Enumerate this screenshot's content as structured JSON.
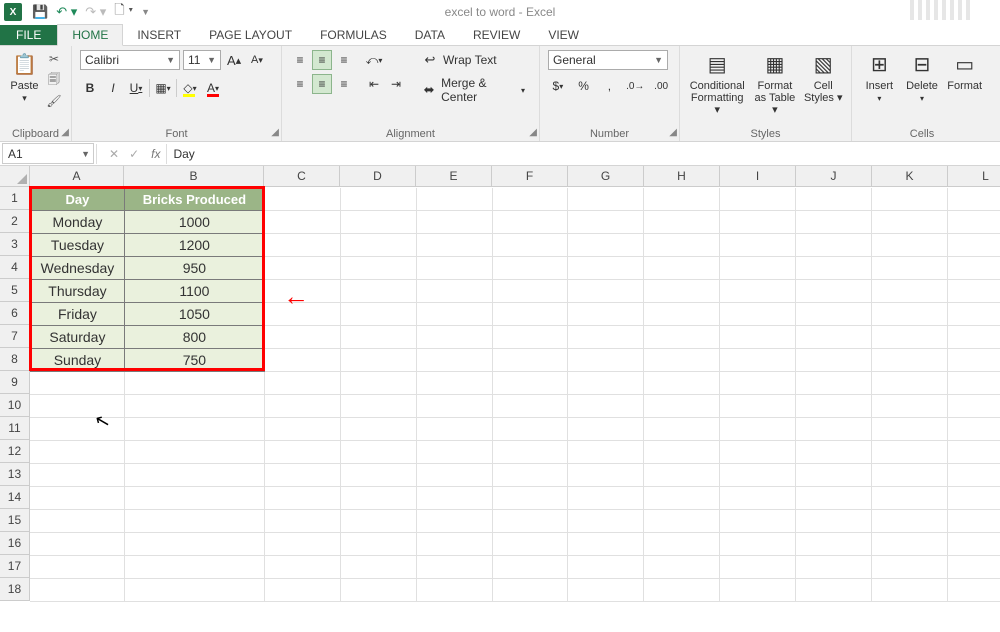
{
  "app": {
    "title": "excel to word - Excel",
    "icon_letter": "X"
  },
  "qat": {
    "save": "💾",
    "undo": "↶",
    "redo": "↷",
    "new": "🗋"
  },
  "tabs": [
    "FILE",
    "HOME",
    "INSERT",
    "PAGE LAYOUT",
    "FORMULAS",
    "DATA",
    "REVIEW",
    "VIEW"
  ],
  "active_tab": "HOME",
  "ribbon": {
    "clipboard": {
      "paste": "Paste",
      "label": "Clipboard"
    },
    "font": {
      "name": "Calibri",
      "size": "11",
      "bold": "B",
      "italic": "I",
      "underline": "U",
      "grow": "A",
      "shrink": "A",
      "label": "Font"
    },
    "alignment": {
      "wrap": "Wrap Text",
      "merge": "Merge & Center",
      "label": "Alignment"
    },
    "number": {
      "format": "General",
      "label": "Number"
    },
    "styles": {
      "cf": "Conditional Formatting",
      "ft": "Format as Table",
      "cs": "Cell Styles",
      "label": "Styles"
    },
    "cells": {
      "ins": "Insert",
      "del": "Delete",
      "fmt": "Format",
      "label": "Cells"
    }
  },
  "fbar": {
    "ref": "A1",
    "content": "Day"
  },
  "columns": [
    "A",
    "B",
    "C",
    "D",
    "E",
    "F",
    "G",
    "H",
    "I",
    "J",
    "K",
    "L"
  ],
  "rows": [
    "1",
    "2",
    "3",
    "4",
    "5",
    "6",
    "7",
    "8",
    "9",
    "10",
    "11",
    "12",
    "13",
    "14",
    "15",
    "16",
    "17",
    "18"
  ],
  "chart_data": {
    "type": "table",
    "headers": [
      "Day",
      "Bricks Produced"
    ],
    "rows": [
      [
        "Monday",
        1000
      ],
      [
        "Tuesday",
        1200
      ],
      [
        "Wednesday",
        950
      ],
      [
        "Thursday",
        1100
      ],
      [
        "Friday",
        1050
      ],
      [
        "Saturday",
        800
      ],
      [
        "Sunday",
        750
      ]
    ]
  },
  "selection": {
    "range": "A1:B8"
  },
  "annotation": {
    "arrow_row": 5
  }
}
